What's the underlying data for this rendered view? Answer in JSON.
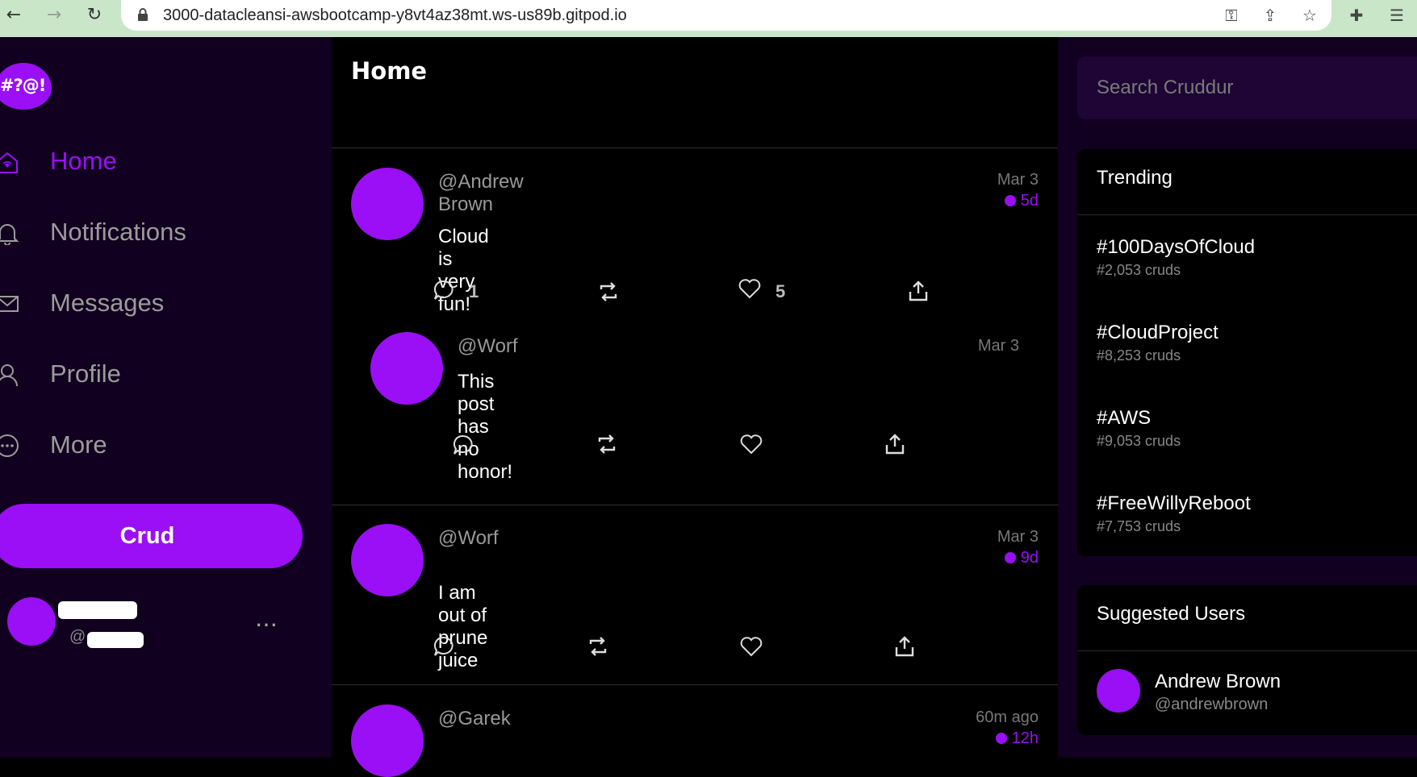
{
  "browser": {
    "url": "3000-datacleansi-awsbootcamp-y8vt4az38mt.ws-us89b.gitpod.io"
  },
  "brand": {
    "logo_text": "#?@!",
    "accent": "#9a0ff5"
  },
  "sidebar": {
    "items": [
      {
        "label": "Home",
        "icon": "home-icon",
        "active": true
      },
      {
        "label": "Notifications",
        "icon": "bell-icon",
        "active": false
      },
      {
        "label": "Messages",
        "icon": "envelope-icon",
        "active": false
      },
      {
        "label": "Profile",
        "icon": "person-icon",
        "active": false
      },
      {
        "label": "More",
        "icon": "more-circle-icon",
        "active": false
      }
    ],
    "crud_button": "Crud",
    "user": {
      "handle_prefix": "@",
      "more": "…"
    }
  },
  "feed": {
    "title": "Home",
    "posts": [
      {
        "handle": "@Andrew Brown",
        "date": "Mar 3",
        "expiry": "5d",
        "message": "Cloud is very fun!",
        "replies": "1",
        "likes": "5"
      },
      {
        "handle": "@Worf",
        "date": "Mar 3",
        "message": "This post has no honor!"
      },
      {
        "handle": "@Worf",
        "date": "Mar 3",
        "expiry": "9d",
        "message": "I am out of prune juice"
      },
      {
        "handle": "@Garek",
        "date": "60m ago",
        "expiry": "12h"
      }
    ]
  },
  "right": {
    "search_placeholder": "Search Cruddur",
    "trending": {
      "title": "Trending",
      "items": [
        {
          "tag": "#100DaysOfCloud",
          "count": "#2,053 cruds"
        },
        {
          "tag": "#CloudProject",
          "count": "#8,253 cruds"
        },
        {
          "tag": "#AWS",
          "count": "#9,053 cruds"
        },
        {
          "tag": "#FreeWillyReboot",
          "count": "#7,753 cruds"
        }
      ]
    },
    "suggested": {
      "title": "Suggested Users",
      "users": [
        {
          "name": "Andrew Brown",
          "handle": "@andrewbrown"
        }
      ]
    }
  }
}
